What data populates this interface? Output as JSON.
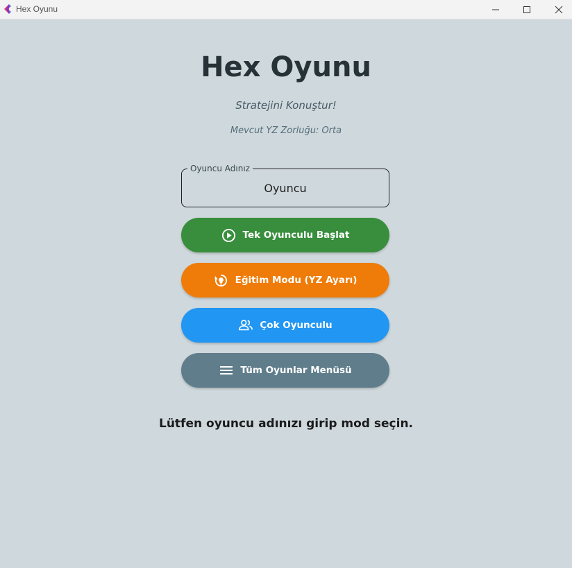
{
  "window": {
    "title": "Hex Oyunu",
    "icons": [
      "app-logo-icon",
      "minimize-icon",
      "maximize-icon",
      "close-icon"
    ]
  },
  "header": {
    "title": "Hex Oyunu",
    "subtitle": "Stratejini Konuştur!",
    "difficulty": "Mevcut YZ Zorluğu: Orta"
  },
  "player_name": {
    "label": "Oyuncu Adınız",
    "value": "Oyuncu"
  },
  "buttons": {
    "single": {
      "label": "Tek Oyunculu Başlat",
      "color": "#388e3c",
      "icon": "play-circle-icon"
    },
    "training": {
      "label": "Eğitim Modu (YZ Ayarı)",
      "color": "#ef7c08",
      "icon": "psychology-icon"
    },
    "multi": {
      "label": "Çok Oyunculu",
      "color": "#2196f3",
      "icon": "people-icon"
    },
    "menu": {
      "label": "Tüm Oyunlar Menüsü",
      "color": "#607d8b",
      "icon": "menu-icon"
    }
  },
  "status": "Lütfen oyuncu adınızı girip mod seçin.",
  "colors": {
    "background": "#cfd8dc",
    "title": "#263238"
  }
}
